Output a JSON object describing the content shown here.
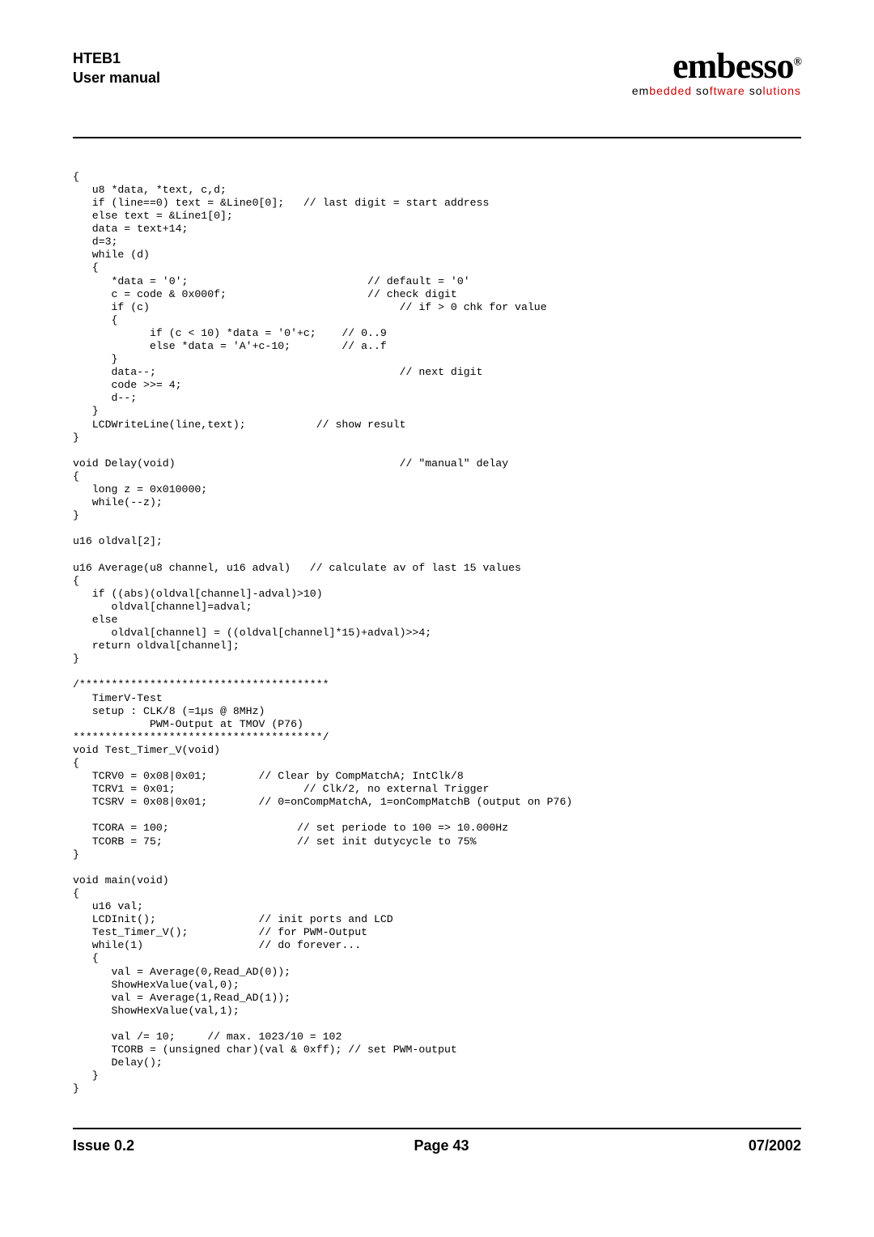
{
  "header": {
    "title_line1": "HTEB1",
    "title_line2": "User manual",
    "logo_main": "embesso",
    "logo_sub_1": "em",
    "logo_sub_2": "bedded ",
    "logo_sub_3": "so",
    "logo_sub_4": "ftware ",
    "logo_sub_5": "so",
    "logo_sub_6": "lutions"
  },
  "code": "{\n   u8 *data, *text, c,d;\n   if (line==0) text = &Line0[0];   // last digit = start address\n   else text = &Line1[0];\n   data = text+14;\n   d=3;\n   while (d)\n   {\n      *data = '0';                            // default = '0'\n      c = code & 0x000f;                      // check digit\n      if (c)                                       // if > 0 chk for value\n      {\n            if (c < 10) *data = '0'+c;    // 0..9\n            else *data = 'A'+c-10;        // a..f\n      }\n      data--;                                      // next digit\n      code >>= 4;\n      d--;\n   }\n   LCDWriteLine(line,text);           // show result\n}\n\nvoid Delay(void)                                   // \"manual\" delay\n{\n   long z = 0x010000;\n   while(--z);\n}\n\nu16 oldval[2];\n\nu16 Average(u8 channel, u16 adval)   // calculate av of last 15 values\n{\n   if ((abs)(oldval[channel]-adval)>10)\n      oldval[channel]=adval;\n   else\n      oldval[channel] = ((oldval[channel]*15)+adval)>>4;\n   return oldval[channel];\n}\n\n/***************************************\n   TimerV-Test\n   setup : CLK/8 (=1µs @ 8MHz)\n            PWM-Output at TMOV (P76)\n***************************************/\nvoid Test_Timer_V(void)\n{\n   TCRV0 = 0x08|0x01;        // Clear by CompMatchA; IntClk/8\n   TCRV1 = 0x01;                    // Clk/2, no external Trigger\n   TCSRV = 0x08|0x01;        // 0=onCompMatchA, 1=onCompMatchB (output on P76)\n\n   TCORA = 100;                    // set periode to 100 => 10.000Hz\n   TCORB = 75;                     // set init dutycycle to 75%\n}\n\nvoid main(void)\n{\n   u16 val;\n   LCDInit();                // init ports and LCD\n   Test_Timer_V();           // for PWM-Output\n   while(1)                  // do forever...\n   {\n      val = Average(0,Read_AD(0));\n      ShowHexValue(val,0);\n      val = Average(1,Read_AD(1));\n      ShowHexValue(val,1);\n\n      val /= 10;     // max. 1023/10 = 102\n      TCORB = (unsigned char)(val & 0xff); // set PWM-output\n      Delay();\n   }\n}",
  "footer": {
    "issue": "Issue 0.2",
    "page": "Page 43",
    "date": "07/2002"
  }
}
